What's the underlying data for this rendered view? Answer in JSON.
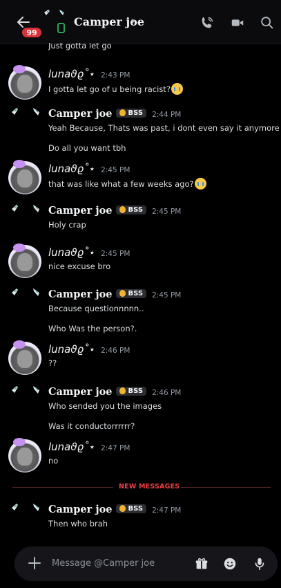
{
  "header": {
    "back_icon": "arrow-left-icon",
    "unread_count": "99",
    "contact_name": "Camper joe",
    "chevron": "›",
    "call_icon": "phone-call-icon",
    "video_icon": "video-camera-icon",
    "search_icon": "search-icon"
  },
  "previous_line": "Just gotta let go",
  "messages": [
    {
      "author": "lunaϑϱ˚⋆",
      "time": "2:43 PM",
      "lines": [
        "I gotta let go of u being racist?"
      ],
      "emoji": "loudly-crying-face"
    },
    {
      "author": "Camper joe",
      "tag": "BSS",
      "time": "2:44 PM",
      "lines": [
        "Yeah Because, Thats was past, i dont even say it anymore",
        "Do all you want tbh"
      ]
    },
    {
      "author": "lunaϑϱ˚⋆",
      "time": "2:45 PM",
      "lines": [
        "that was like what a few weeks ago?"
      ],
      "emoji": "loudly-crying-face"
    },
    {
      "author": "Camper joe",
      "tag": "BSS",
      "time": "2:45 PM",
      "lines": [
        "Holy crap"
      ]
    },
    {
      "author": "lunaϑϱ˚⋆",
      "time": "2:45 PM",
      "lines": [
        "nice excuse bro"
      ]
    },
    {
      "author": "Camper joe",
      "tag": "BSS",
      "time": "2:45 PM",
      "lines": [
        "Because questionnnnn..",
        "Who Was the person?."
      ]
    },
    {
      "author": "lunaϑϱ˚⋆",
      "time": "2:46 PM",
      "lines": [
        "??"
      ]
    },
    {
      "author": "Camper joe",
      "tag": "BSS",
      "time": "2:46 PM",
      "lines": [
        "Who sended you the images",
        "Was it conductorrrrrr?"
      ]
    },
    {
      "author": "lunaϑϱ˚⋆",
      "time": "2:47 PM",
      "lines": [
        "no"
      ]
    },
    {
      "author": "Camper joe",
      "tag": "BSS",
      "time": "2:47 PM",
      "lines": [
        "Then who brah"
      ]
    }
  ],
  "divider": {
    "label": "NEW MESSAGES",
    "color": "#f23f43"
  },
  "composer": {
    "placeholder": "Message @Camper joe",
    "plus_icon": "plus-icon",
    "gift_icon": "gift-icon",
    "emoji_icon": "emoji-smile-icon",
    "mic_icon": "microphone-icon"
  }
}
